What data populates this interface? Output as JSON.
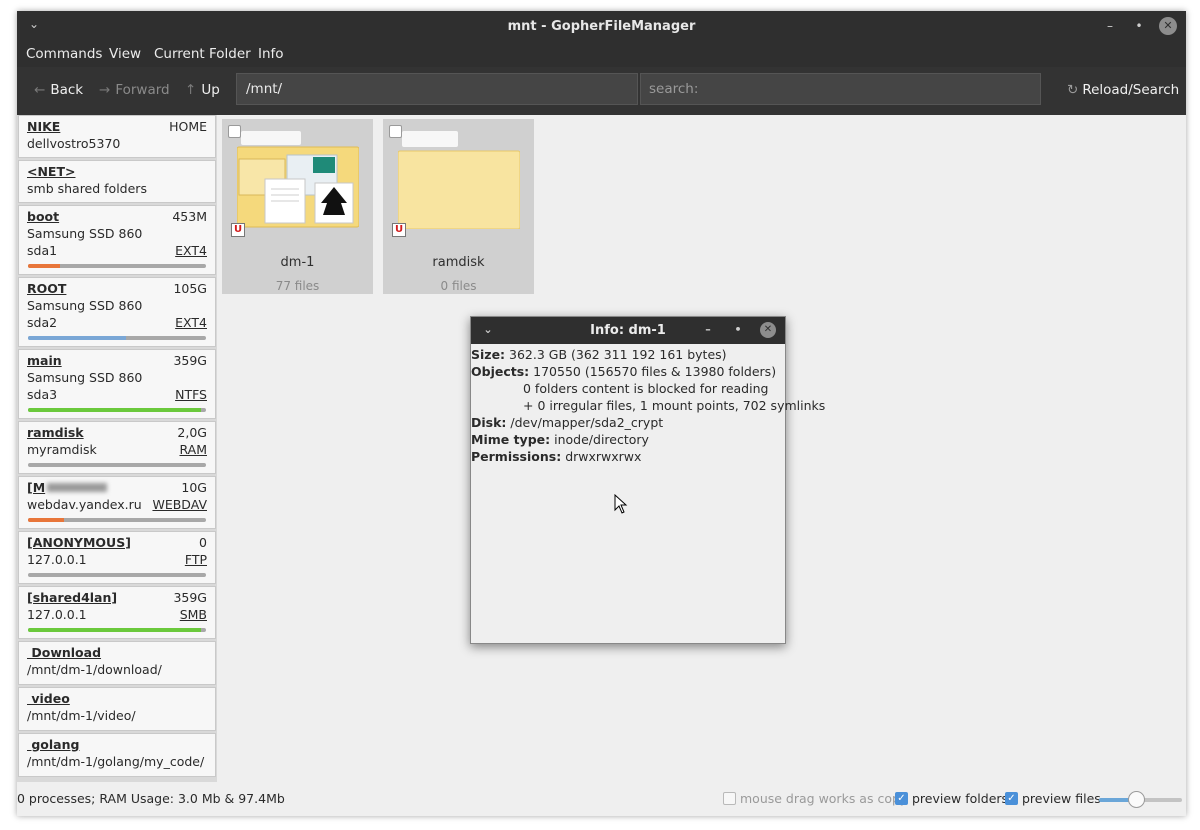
{
  "window": {
    "title": "mnt - GopherFileManager"
  },
  "menu": {
    "commands": "Commands",
    "view": "View",
    "current_folder": "Current Folder",
    "info": "Info"
  },
  "toolbar": {
    "back": "Back",
    "forward": "Forward",
    "up": "Up",
    "path": "/mnt/",
    "search_placeholder": "search:",
    "reload": "Reload/Search"
  },
  "sidebar": {
    "home": {
      "name": "NIKE",
      "tag": "HOME",
      "sub": "dellvostro5370"
    },
    "net": {
      "name": "<NET>",
      "sub": "smb shared folders"
    },
    "drives": [
      {
        "name": "boot",
        "size": "453M",
        "model": "Samsung SSD 860",
        "dev": "sda1",
        "fs": "EXT4",
        "usage": 0.18,
        "color": "#e8763a"
      },
      {
        "name": "ROOT",
        "size": "105G",
        "model": "Samsung SSD 860",
        "dev": "sda2",
        "fs": "EXT4",
        "usage": 0.55,
        "color": "#7aa7d6"
      },
      {
        "name": "main",
        "size": "359G",
        "model": "Samsung SSD 860",
        "dev": "sda3",
        "fs": "NTFS",
        "usage": 0.97,
        "color": "#6bc93c"
      }
    ],
    "ramdisk": {
      "name": "ramdisk",
      "size": "2,0G",
      "sub": "myramdisk",
      "fs": "RAM",
      "usage": 0.0,
      "color": "#6bc93c"
    },
    "webdav": {
      "name": "[M",
      "size": "10G",
      "sub": "webdav.yandex.ru",
      "fs": "WEBDAV",
      "usage": 0.2,
      "color": "#e8763a"
    },
    "ftp": {
      "name": "[ANONYMOUS]",
      "size": "0",
      "sub": "127.0.0.1",
      "fs": "FTP",
      "usage": 0.0,
      "color": "#6bc93c"
    },
    "smb": {
      "name": "[shared4lan]",
      "size": "359G",
      "sub": "127.0.0.1",
      "fs": "SMB",
      "usage": 0.97,
      "color": "#6bc93c"
    },
    "bookmarks": [
      {
        "name": " Download",
        "path": "/mnt/dm-1/download/"
      },
      {
        "name": " video",
        "path": "/mnt/dm-1/video/"
      },
      {
        "name": " golang",
        "path": "/mnt/dm-1/golang/my_code/"
      }
    ]
  },
  "files": [
    {
      "name": "dm-1",
      "count": "77 files",
      "badge": "U"
    },
    {
      "name": "ramdisk",
      "count": "0 files",
      "badge": "U"
    }
  ],
  "info_dialog": {
    "title": "Info: dm-1",
    "size_label": "Size:",
    "size_value": "362.3 GB (362 311 192 161 bytes)",
    "objects_label": "Objects:",
    "objects_value": "170550 (156570 files & 13980 folders)",
    "objects_line2": "0 folders content is blocked for reading",
    "objects_line3": "+ 0 irregular files, 1 mount points, 702 symlinks",
    "disk_label": "Disk:",
    "disk_value": "/dev/mapper/sda2_crypt",
    "mime_label": "Mime type:",
    "mime_value": "inode/directory",
    "perm_label": "Permissions:",
    "perm_value": "drwxrwxrwx"
  },
  "status": {
    "text": "0 processes; RAM Usage: 3.0 Mb & 97.4Mb",
    "drag_copy": "mouse drag works as copy",
    "drag_copy_checked": false,
    "preview_folders": "preview folders",
    "preview_folders_checked": true,
    "preview_files": "preview files",
    "preview_files_checked": true,
    "zoom": 0.45
  }
}
